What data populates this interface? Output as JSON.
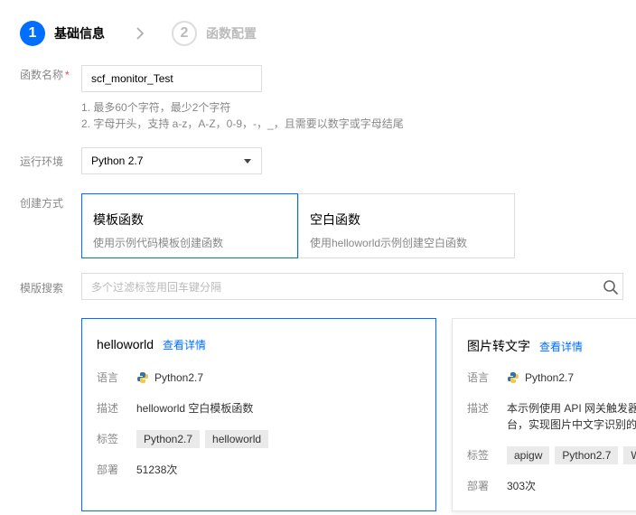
{
  "steps": [
    {
      "number": "1",
      "label": "基础信息"
    },
    {
      "number": "2",
      "label": "函数配置"
    }
  ],
  "form": {
    "function_name": {
      "label": "函数名称",
      "required_mark": "*",
      "value": "scf_monitor_Test",
      "hints": [
        "1. 最多60个字符，最少2个字符",
        "2. 字母开头，支持 a-z，A-Z，0-9，-，_，且需要以数字或字母结尾"
      ]
    },
    "runtime": {
      "label": "运行环境",
      "value": "Python 2.7"
    },
    "create_mode": {
      "label": "创建方式",
      "options": [
        {
          "title": "模板函数",
          "desc": "使用示例代码模板创建函数"
        },
        {
          "title": "空白函数",
          "desc": "使用helloworld示例创建空白函数"
        }
      ]
    },
    "template_search": {
      "label": "模版搜索",
      "placeholder": "多个过滤标签用回车键分隔"
    }
  },
  "templates": [
    {
      "name": "helloworld",
      "link": "查看详情",
      "lang_key": "语言",
      "lang": "Python2.7",
      "desc_key": "描述",
      "desc": "helloworld 空白模板函数",
      "tags_key": "标签",
      "tags": [
        "Python2.7",
        "helloworld"
      ],
      "deploy_key": "部署",
      "deploys": "51238次"
    },
    {
      "name": "图片转文字",
      "link": "查看详情",
      "lang_key": "语言",
      "lang": "Python2.7",
      "desc_key": "描述",
      "desc_line1": "本示例使用 API 网关触发器",
      "desc_line2": "台，实现图片中文字识别的",
      "tags_key": "标签",
      "tags": [
        "apigw",
        "Python2.7",
        "W"
      ],
      "deploy_key": "部署",
      "deploys": "303次"
    }
  ],
  "colors": {
    "accent": "#006eff",
    "required": "#e54545"
  }
}
